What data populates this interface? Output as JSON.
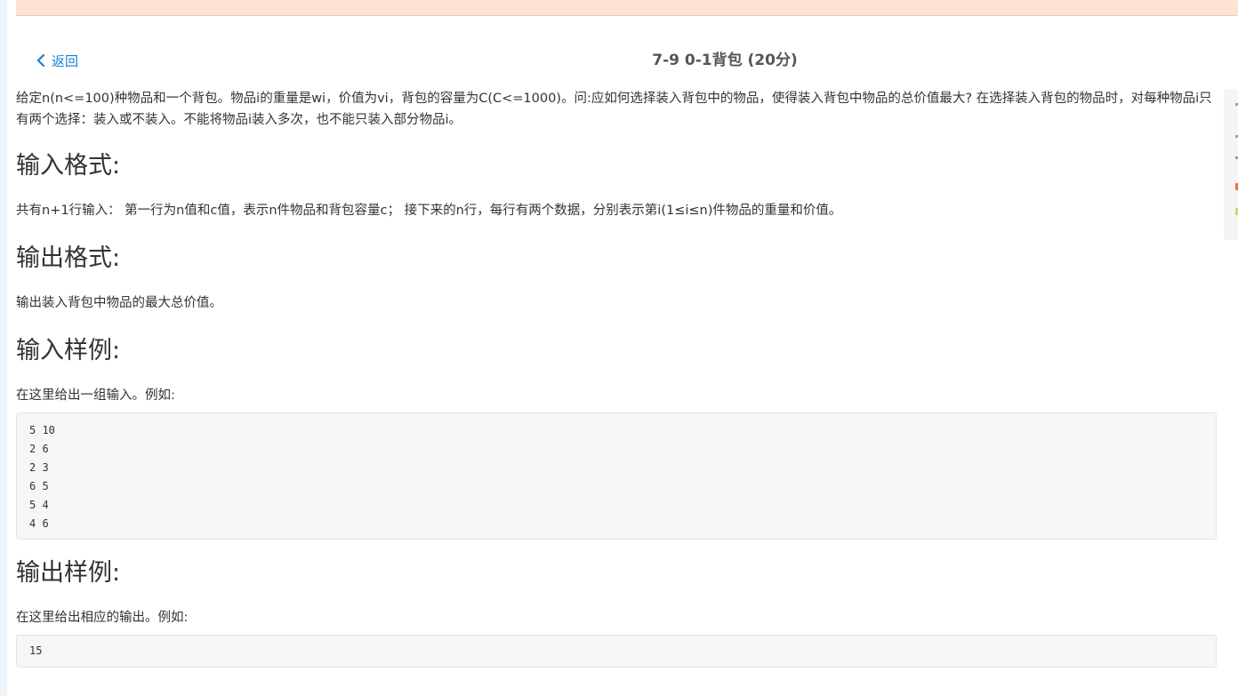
{
  "header": {
    "back_label": "返回",
    "title": "7-9 0-1背包 (20分)"
  },
  "problem": {
    "description": "给定n(n<=100)种物品和一个背包。物品i的重量是wi，价值为vi，背包的容量为C(C<=1000)。问:应如何选择装入背包中的物品，使得装入背包中物品的总价值最大? 在选择装入背包的物品时，对每种物品i只有两个选择：装入或不装入。不能将物品i装入多次，也不能只装入部分物品i。",
    "input_format_heading": "输入格式:",
    "input_format_text": "共有n+1行输入： 第一行为n值和c值，表示n件物品和背包容量c； 接下来的n行，每行有两个数据，分别表示第i(1≤i≤n)件物品的重量和价值。",
    "output_format_heading": "输出格式:",
    "output_format_text": "输出装入背包中物品的最大总价值。",
    "input_sample_heading": "输入样例:",
    "input_sample_intro": "在这里给出一组输入。例如:",
    "input_sample_code": "5 10\n2 6\n2 3\n6 5\n5 4\n4 6",
    "output_sample_heading": "输出样例:",
    "output_sample_intro": "在这里给出相应的输出。例如:",
    "output_sample_code": "15"
  },
  "colors": {
    "link": "#1b7fd8",
    "banner": "#fde3d5",
    "code_bg": "#f6f6f6"
  }
}
